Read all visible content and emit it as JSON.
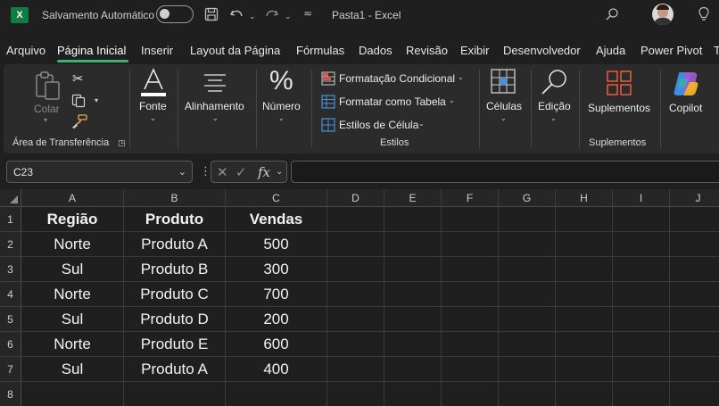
{
  "titlebar": {
    "logo": "X",
    "autosave_label": "Salvamento Automático",
    "autosave_on": false,
    "doc_title": "Pasta1  -  Excel",
    "icons": [
      "excel-logo-icon",
      "save-icon",
      "undo-icon",
      "redo-icon",
      "customize-icon",
      "search-icon",
      "avatar",
      "lightbulb-icon"
    ]
  },
  "menu": {
    "items": [
      "Arquivo",
      "Página Inicial",
      "Inserir",
      "Layout da Página",
      "Fórmulas",
      "Dados",
      "Revisão",
      "Exibir",
      "Desenvolvedor",
      "Ajuda",
      "Power Pivot",
      "T"
    ],
    "active_index": 1,
    "accent": "#3fb070"
  },
  "ribbon": {
    "clipboard": {
      "paste_label": "Colar",
      "group_label": "Área de Transferência"
    },
    "font_label": "Fonte",
    "alignment_label": "Alinhamento",
    "number_label": "Número",
    "styles": {
      "conditional_formatting": "Formatação Condicional",
      "format_as_table": "Formatar como Tabela",
      "cell_styles": "Estilos de Célula",
      "group_label": "Estilos"
    },
    "cells_label": "Células",
    "editing_label": "Edição",
    "addins": {
      "button_label": "Suplementos",
      "group_label": "Suplementos"
    },
    "copilot_label": "Copilot"
  },
  "formula_bar": {
    "name_box": "C23",
    "formula": ""
  },
  "sheet": {
    "columns": [
      "A",
      "B",
      "C",
      "D",
      "E",
      "F",
      "G",
      "H",
      "I",
      "J"
    ],
    "rows": [
      "1",
      "2",
      "3",
      "4",
      "5",
      "6",
      "7",
      "8"
    ],
    "cells": [
      [
        "Região",
        "Produto",
        "Vendas"
      ],
      [
        "Norte",
        "Produto A",
        "500"
      ],
      [
        "Sul",
        "Produto B",
        "300"
      ],
      [
        "Norte",
        "Produto C",
        "700"
      ],
      [
        "Sul",
        "Produto D",
        "200"
      ],
      [
        "Norte",
        "Produto E",
        "600"
      ],
      [
        "Sul",
        "Produto A",
        "400"
      ]
    ]
  }
}
